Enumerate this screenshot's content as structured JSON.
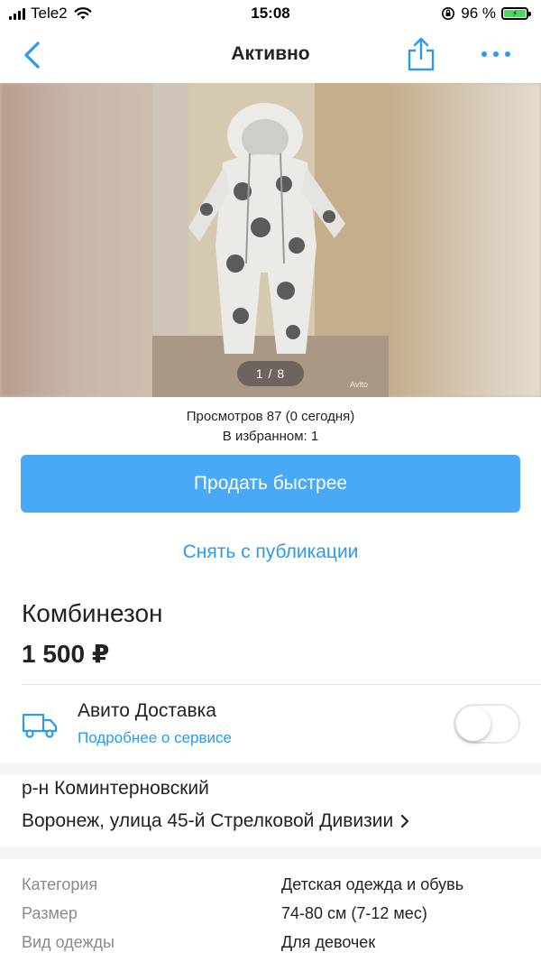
{
  "status_bar": {
    "carrier": "Tele2",
    "time": "15:08",
    "battery_percent": "96 %",
    "icons": [
      "signal-icon",
      "wifi-icon",
      "orientation-lock-icon",
      "battery-charging-icon"
    ]
  },
  "navbar": {
    "title": "Активно",
    "icons": [
      "chevron-left-icon",
      "share-icon",
      "more-dots-icon"
    ],
    "accent_color": "#2b9af3"
  },
  "gallery": {
    "pager": "1 / 8",
    "watermark": "Avito"
  },
  "stats": {
    "views": "Просмотров 87 (0 сегодня)",
    "favorites": "В избранном: 1"
  },
  "actions": {
    "sell_faster": "Продать быстрее",
    "unpublish": "Снять с публикации",
    "primary_color": "#4aa9f5"
  },
  "listing": {
    "title": "Комбинезон",
    "price": "1 500 ₽"
  },
  "delivery": {
    "title": "Авито Доставка",
    "link": "Подробнее о сервисе",
    "enabled": false,
    "icon": "delivery-truck-icon"
  },
  "address": {
    "district": "р-н Коминтерновский",
    "street": "Воронеж, улица 45-й Стрелковой Дивизии"
  },
  "params": [
    {
      "key": "Категория",
      "value": "Детская одежда и обувь"
    },
    {
      "key": "Размер",
      "value": "74-80 см (7-12 мес)"
    },
    {
      "key": "Вид одежды",
      "value": "Для девочек"
    }
  ]
}
